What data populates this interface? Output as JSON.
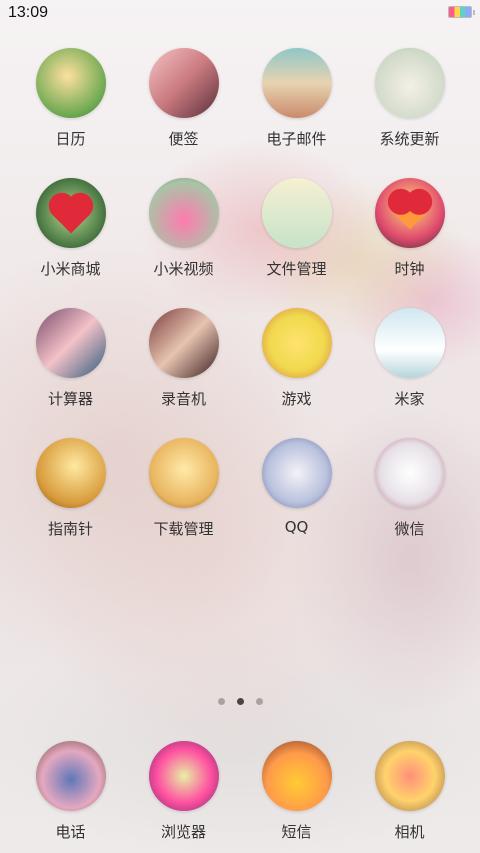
{
  "status_bar": {
    "time": "13:09"
  },
  "apps": [
    {
      "name": "calendar",
      "label": "日历",
      "icon": "calendar-icon",
      "style": "ic-calendar"
    },
    {
      "name": "notes",
      "label": "便签",
      "icon": "notes-icon",
      "style": "ic-notes"
    },
    {
      "name": "email",
      "label": "电子邮件",
      "icon": "email-icon",
      "style": "ic-mail"
    },
    {
      "name": "system-update",
      "label": "系统更新",
      "icon": "system-update-icon",
      "style": "ic-update"
    },
    {
      "name": "mi-store",
      "label": "小米商城",
      "icon": "mi-store-icon",
      "style": "ic-store"
    },
    {
      "name": "mi-video",
      "label": "小米视频",
      "icon": "mi-video-icon",
      "style": "ic-video"
    },
    {
      "name": "file-manager",
      "label": "文件管理",
      "icon": "file-manager-icon",
      "style": "ic-files"
    },
    {
      "name": "clock",
      "label": "时钟",
      "icon": "clock-icon",
      "style": "ic-clock"
    },
    {
      "name": "calculator",
      "label": "计算器",
      "icon": "calculator-icon",
      "style": "ic-calc"
    },
    {
      "name": "recorder",
      "label": "录音机",
      "icon": "recorder-icon",
      "style": "ic-recorder"
    },
    {
      "name": "games",
      "label": "游戏",
      "icon": "games-icon",
      "style": "ic-game"
    },
    {
      "name": "mijia",
      "label": "米家",
      "icon": "mijia-icon",
      "style": "ic-mijia"
    },
    {
      "name": "compass",
      "label": "指南针",
      "icon": "compass-icon",
      "style": "ic-compass"
    },
    {
      "name": "download-manager",
      "label": "下载管理",
      "icon": "download-manager-icon",
      "style": "ic-download"
    },
    {
      "name": "qq",
      "label": "QQ",
      "icon": "qq-icon",
      "style": "ic-qq"
    },
    {
      "name": "wechat",
      "label": "微信",
      "icon": "wechat-icon",
      "style": "ic-wechat"
    }
  ],
  "page_indicator": {
    "count": 3,
    "active": 2
  },
  "dock": [
    {
      "name": "phone",
      "label": "电话",
      "icon": "phone-icon",
      "style": "ic-phone"
    },
    {
      "name": "browser",
      "label": "浏览器",
      "icon": "browser-icon",
      "style": "ic-browser"
    },
    {
      "name": "messages",
      "label": "短信",
      "icon": "messages-icon",
      "style": "ic-sms"
    },
    {
      "name": "camera",
      "label": "相机",
      "icon": "camera-icon",
      "style": "ic-camera"
    }
  ]
}
